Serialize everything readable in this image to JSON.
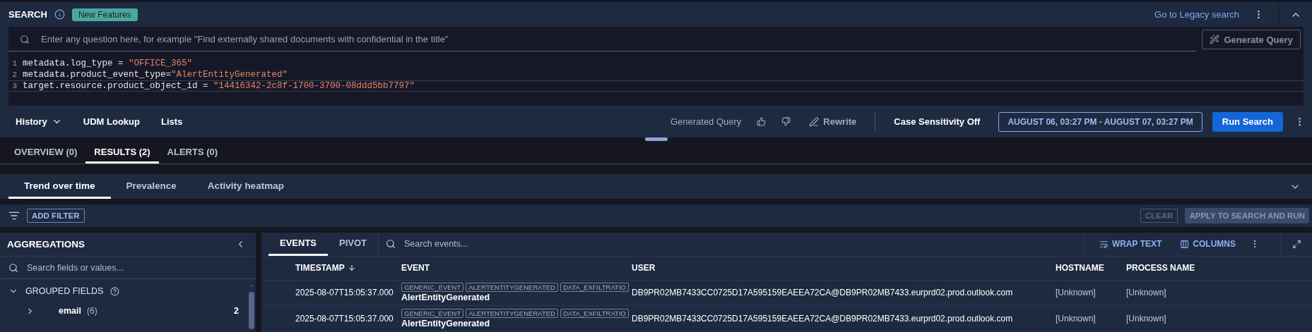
{
  "header": {
    "title": "SEARCH",
    "badge": "New Features",
    "legacy_link": "Go to Legacy search"
  },
  "query": {
    "placeholder": "Enter any question here, for example \"Find externally shared documents with confidential in the title\"",
    "generate_button": "Generate Query",
    "lines": [
      {
        "number": "1",
        "active": false,
        "parts": [
          {
            "kind": "key",
            "text": "metadata.log_type = "
          },
          {
            "kind": "string",
            "text": "\"OFFICE_365\""
          }
        ]
      },
      {
        "number": "2",
        "active": false,
        "parts": [
          {
            "kind": "key",
            "text": "metadata.product_event_type="
          },
          {
            "kind": "string",
            "text": "\"AlertEntityGenerated\""
          }
        ]
      },
      {
        "number": "3",
        "active": true,
        "parts": [
          {
            "kind": "key",
            "text": "target.resource.product_object_id = "
          },
          {
            "kind": "string",
            "text": "\"14416342-2c8f-1700-3700-08ddd5bb7797\""
          }
        ]
      }
    ]
  },
  "toolbar": {
    "buttons": [
      {
        "label": "History",
        "kind": "dropdown"
      },
      {
        "label": "UDM Lookup",
        "kind": "plain"
      },
      {
        "label": "Lists",
        "kind": "plain"
      }
    ],
    "generated_label": "Generated Query",
    "rewrite": "Rewrite",
    "case_sensitivity": "Case Sensitivity Off",
    "date_range": "AUGUST 06, 03:27 PM - AUGUST 07, 03:27 PM",
    "run": "Run Search"
  },
  "result_tabs": [
    {
      "label": "OVERVIEW (0)",
      "selected": false
    },
    {
      "label": "RESULTS (2)",
      "selected": true
    },
    {
      "label": "ALERTS (0)",
      "selected": false
    }
  ],
  "view_tabs": [
    {
      "label": "Trend over time",
      "selected": true
    },
    {
      "label": "Prevalence",
      "selected": false
    },
    {
      "label": "Activity heatmap",
      "selected": false
    }
  ],
  "filter_bar": {
    "add_filter": "ADD FILTER",
    "clear": {
      "label": "CLEAR",
      "disabled": true
    },
    "apply": {
      "label": "APPLY TO SEARCH AND RUN",
      "disabled": true
    }
  },
  "aggregations": {
    "title": "AGGREGATIONS",
    "search_placeholder": "Search fields or values...",
    "groups": [
      {
        "label": "GROUPED FIELDS",
        "expanded": true,
        "children": [
          {
            "name": "email",
            "count": "(6)",
            "value": "2",
            "expanded": false
          }
        ]
      }
    ]
  },
  "events": {
    "tabs": [
      {
        "label": "EVENTS",
        "selected": true
      },
      {
        "label": "PIVOT",
        "selected": false
      }
    ],
    "search_placeholder": "Search events...",
    "wrap_text": "WRAP TEXT",
    "columns_button": "COLUMNS",
    "columns": [
      "TIMESTAMP",
      "EVENT",
      "USER",
      "HOSTNAME",
      "PROCESS NAME"
    ],
    "rows": [
      {
        "timestamp": "2025-08-07T15:05:37.000",
        "tags": [
          "GENERIC_EVENT",
          "ALERTENTITYGENERATED",
          "DATA_EXFILTRATIO"
        ],
        "event": "AlertEntityGenerated",
        "user": "DB9PR02MB7433CC0725D17A595159EAEEA72CA@DB9PR02MB7433.eurprd02.prod.outlook.com",
        "hostname": "[Unknown]",
        "process": "[Unknown]"
      },
      {
        "timestamp": "2025-08-07T15:05:37.000",
        "tags": [
          "GENERIC_EVENT",
          "ALERTENTITYGENERATED",
          "DATA_EXFILTRATIO"
        ],
        "event": "AlertEntityGenerated",
        "user": "DB9PR02MB7433CC0725D17A595159EAEEA72CA@DB9PR02MB7433.eurprd02.prod.outlook.com",
        "hostname": "[Unknown]",
        "process": "[Unknown]"
      }
    ]
  }
}
